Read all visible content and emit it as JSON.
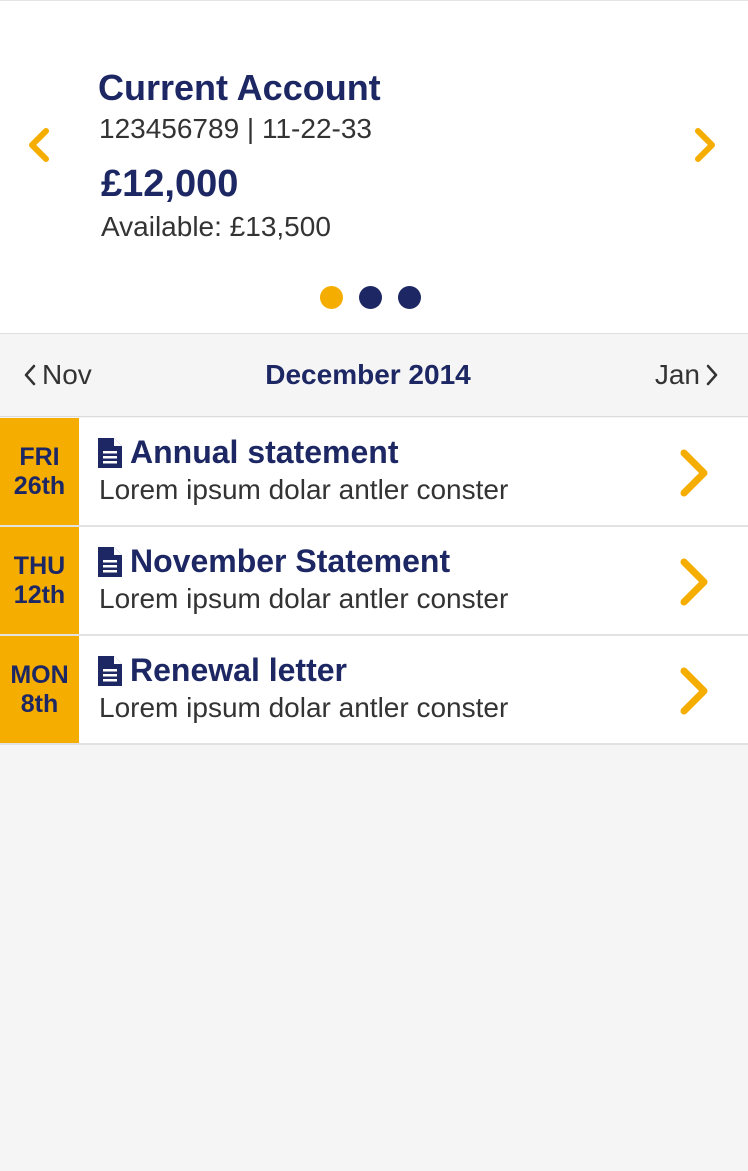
{
  "account": {
    "title": "Current Account",
    "number": "123456789 | 11-22-33",
    "balance": "£12,000",
    "available": "Available: £13,500",
    "carousel": {
      "total": 3,
      "active_index": 0
    }
  },
  "month_nav": {
    "prev_label": "Nov",
    "current_label": "December 2014",
    "next_label": "Jan"
  },
  "documents": [
    {
      "day": "FRI",
      "date": "26th",
      "title": "Annual statement",
      "subtitle": "Lorem ipsum dolar antler conster",
      "icon": "document-icon"
    },
    {
      "day": "THU",
      "date": "12th",
      "title": "November Statement",
      "subtitle": "Lorem ipsum dolar antler conster",
      "icon": "document-icon"
    },
    {
      "day": "MON",
      "date": "8th",
      "title": "Renewal letter",
      "subtitle": "Lorem ipsum dolar antler conster",
      "icon": "document-icon"
    }
  ],
  "colors": {
    "navy": "#1c2763",
    "accent_yellow": "#f5ad00",
    "background": "#f5f5f5",
    "text_gray": "#333333"
  }
}
